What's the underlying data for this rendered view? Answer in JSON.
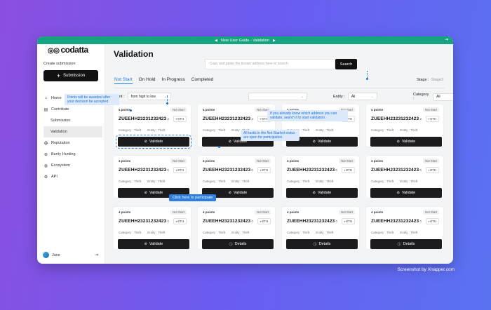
{
  "window": {
    "title": "New User Guide - Validation"
  },
  "sidebar": {
    "logo_text": "codatta",
    "create_label": "Create submission",
    "submission_button": "Submission",
    "items": [
      {
        "label": "Home",
        "icon": "home-icon"
      },
      {
        "label": "Contribute",
        "icon": "contribute-icon"
      },
      {
        "label": "Submission",
        "sub": true
      },
      {
        "label": "Validation",
        "sub": true,
        "active": true
      },
      {
        "label": "Reputation",
        "icon": "reputation-icon"
      },
      {
        "label": "Bunty Hunting",
        "icon": "bounty-icon"
      },
      {
        "label": "Ecosystem",
        "icon": "ecosystem-icon"
      },
      {
        "label": "API",
        "icon": "api-icon"
      }
    ],
    "user_name": "Jane"
  },
  "main": {
    "title": "Validation",
    "search_placeholder": "Copy and paste the known address here to search",
    "search_button": "Search",
    "tabs": [
      "Not Start",
      "On Hold",
      "In Progress",
      "Completed"
    ],
    "stage_label": "Stage :",
    "stage_value": "Stage3",
    "point_label": "Point :",
    "point_value": "from high to low",
    "entity_label": "Entity :",
    "entity_value": "All",
    "category_label": "Category :",
    "category_value": "All"
  },
  "cards": [
    {
      "points": "4 points",
      "status": "Not Start",
      "code": "ZUEEHH23231232423",
      "chain": "ETH",
      "category": "Category : Theft",
      "entity": "Entity : Theft",
      "action": "Validate"
    },
    {
      "points": "4 points",
      "status": "Not Start",
      "code": "ZUEEHH23231232423",
      "chain": "ETH",
      "category": "Category : Theft",
      "entity": "Entity : Theft",
      "action": "Validate"
    },
    {
      "points": "4 points",
      "status": "Not Start",
      "code": "ZUEEHH23231232423",
      "chain": "ETH",
      "category": "Category : Theft",
      "entity": "Entity : Theft",
      "action": "Validate"
    },
    {
      "points": "4 points",
      "status": "Not Start",
      "code": "ZUEEHH23231232423",
      "chain": "ETH",
      "category": "Category : Theft",
      "entity": "Entity : Theft",
      "action": "Validate"
    },
    {
      "points": "4 points",
      "status": "Not Start",
      "code": "ZUEEHH23231232423",
      "chain": "ETH",
      "category": "Category : Theft",
      "entity": "Entity : Theft",
      "action": "Validate"
    },
    {
      "points": "4 points",
      "status": "Not Start",
      "code": "ZUEEHH23231232423",
      "chain": "ETH",
      "category": "Category : Theft",
      "entity": "Entity : Theft",
      "action": "Validate"
    },
    {
      "points": "4 points",
      "status": "Not Start",
      "code": "ZUEEHH23231232423",
      "chain": "ETH",
      "category": "Category : Theft",
      "entity": "Entity : Theft",
      "action": "Validate"
    },
    {
      "points": "4 points",
      "status": "Not Start",
      "code": "ZUEEHH23231232423",
      "chain": "ETH",
      "category": "Category : Theft",
      "entity": "Entity : Theft",
      "action": "Validate"
    },
    {
      "points": "4 points",
      "status": "Not Start",
      "code": "ZUEEHH23231232423",
      "chain": "ETH",
      "category": "Category : Theft",
      "entity": "Entity : Theft",
      "action": "Validate"
    },
    {
      "points": "4 points",
      "status": "Not Start",
      "code": "ZUEEHH23231232423",
      "chain": "ETH",
      "category": "Category : Theft",
      "entity": "Entity : Theft",
      "action": "Details"
    },
    {
      "points": "4 points",
      "status": "Not Start",
      "code": "ZUEEHH23231232423",
      "chain": "ETH",
      "category": "Category : Theft",
      "entity": "Entity : Theft",
      "action": "Details"
    },
    {
      "points": "4 points",
      "status": "Not Start",
      "code": "ZUEEHH23231232423",
      "chain": "ETH",
      "category": "Category : Theft",
      "entity": "Entity : Theft",
      "action": "Details"
    }
  ],
  "tooltips": {
    "points": "Points will be awarded after your decision be accepted",
    "not_started": "All tasks in the Not Started status are open for participation",
    "search": "If you already know which address you can validate, search it to start validation.",
    "participate": "Click here to participate"
  },
  "credit": "Screenshot by Xnapper.com",
  "colors": {
    "accent": "#1e78d6",
    "topbar": "#16a37f",
    "button": "#1c1c1e"
  }
}
